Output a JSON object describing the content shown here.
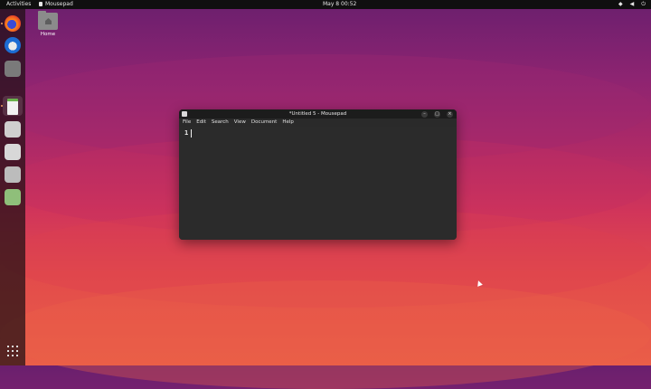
{
  "topbar": {
    "activities": "Activities",
    "app_name": "Mousepad",
    "clock": "May 8  00:52",
    "tray_icons": [
      "network-icon",
      "volume-icon",
      "power-icon"
    ]
  },
  "desktop": {
    "home_label": "Home"
  },
  "dock": {
    "apps": [
      "firefox",
      "thunderbird",
      "files",
      "text-editor",
      "app-5",
      "app-6",
      "app-7",
      "trash"
    ],
    "show_apps": "apps-grid"
  },
  "window": {
    "title": "*Untitled 5 - Mousepad",
    "menu": [
      "File",
      "Edit",
      "Search",
      "View",
      "Document",
      "Help"
    ],
    "line_number": "1"
  },
  "colors": {
    "window_bg": "#262626",
    "accent": "#e95420"
  }
}
